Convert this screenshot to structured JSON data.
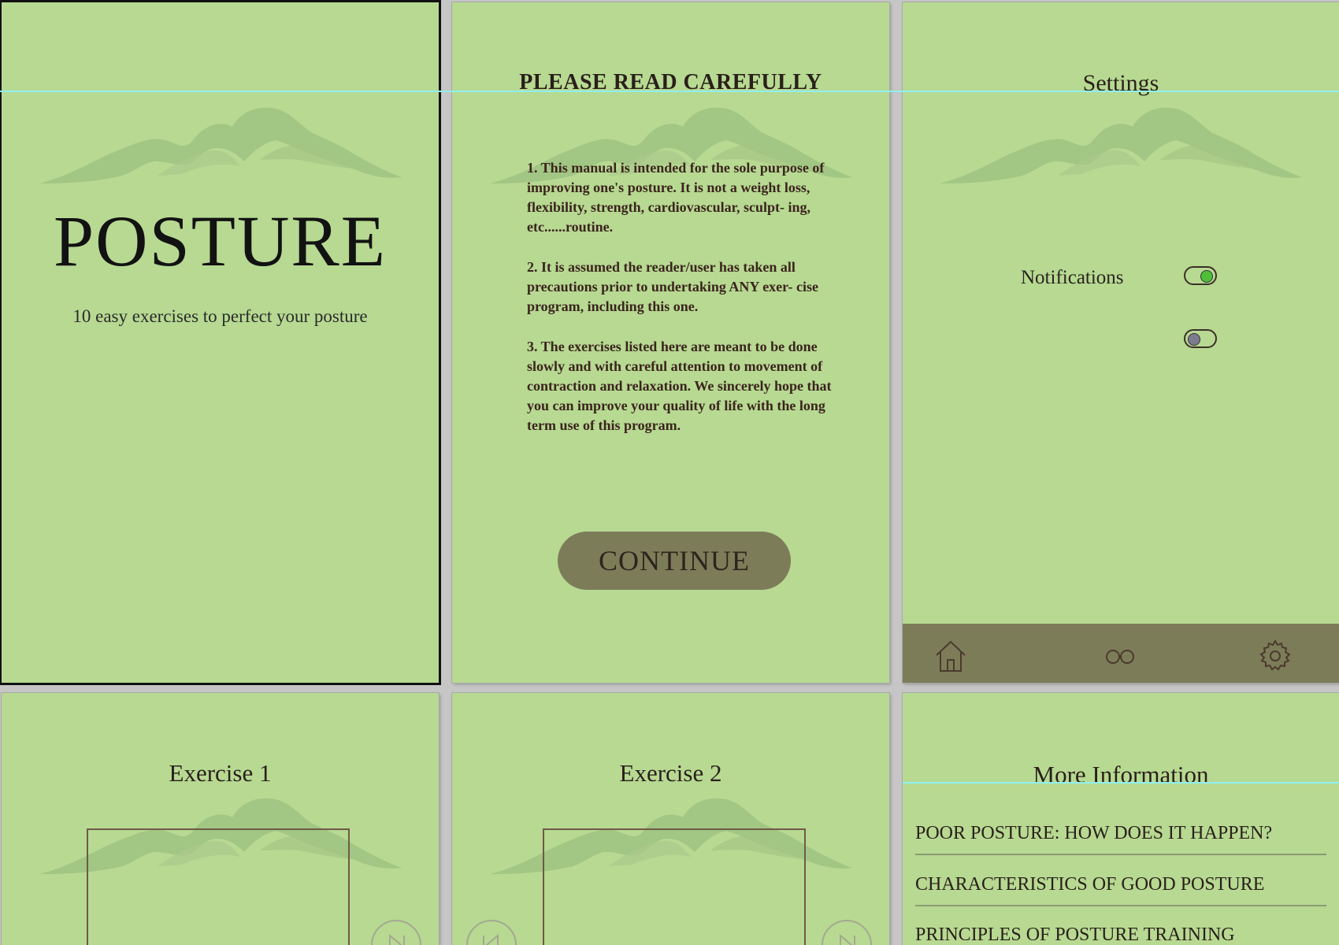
{
  "screen1": {
    "title": "POSTURE",
    "subtitle": "10 easy exercises to perfect your posture"
  },
  "screen2": {
    "heading": "PLEASE READ CAREFULLY",
    "paragraphs": [
      "1. This manual is intended for the sole purpose of improving one's posture. It is not a weight loss, flexibility, strength, cardiovascular, sculpt- ing, etc......routine.",
      "2. It is assumed the reader/user has taken all precautions prior to undertaking ANY exer- cise program, including this one.",
      "3. The exercises listed here are meant to be done slowly and with careful attention to movement of contraction and relaxation. We sincerely hope that you can improve your quality of life with the long term use of this program."
    ],
    "continue_label": "CONTINUE"
  },
  "screen3": {
    "heading": "Settings",
    "notifications_label": "Notifications",
    "toggles": [
      {
        "state": "on"
      },
      {
        "state": "off"
      }
    ],
    "nav": [
      {
        "icon": "home-icon"
      },
      {
        "icon": "glasses-icon"
      },
      {
        "icon": "gear-icon"
      }
    ]
  },
  "screen4": {
    "title": "Exercise 1"
  },
  "screen5": {
    "title": "Exercise 2"
  },
  "screen6": {
    "heading": "More Information",
    "items": [
      "POOR POSTURE: HOW DOES IT HAPPEN?",
      "CHARACTERISTICS OF GOOD POSTURE",
      "PRINCIPLES OF POSTURE TRAINING"
    ]
  },
  "colors": {
    "screen_bg": "#b7d992",
    "accent": "#7d7c59",
    "text": "#2a1f1a",
    "toggle_on": "#4fbf3a"
  }
}
